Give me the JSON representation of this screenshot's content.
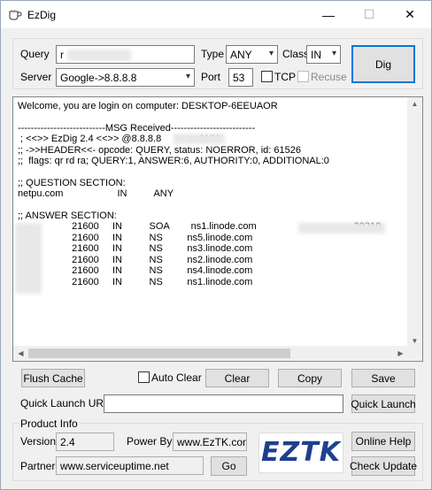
{
  "window": {
    "title": "EzDig",
    "minimize_glyph": "—",
    "maximize_glyph": "☐",
    "close_glyph": "✕"
  },
  "query": {
    "query_label": "Query",
    "query_value": "r",
    "type_label": "Type",
    "type_value": "ANY",
    "class_label": "Class",
    "class_value": "IN",
    "server_label": "Server",
    "server_value": "Google->8.8.8.8",
    "port_label": "Port",
    "port_value": "53",
    "tcp_label": "TCP",
    "tcp_checked": false,
    "recurse_label": "Recuse",
    "recurse_enabled": false,
    "dig_label": "Dig"
  },
  "output": {
    "lines": [
      "Welcome, you are login on computer: DESKTOP-6EEUAOR",
      "",
      "---------------------------MSG Received--------------------------",
      " ; <<>> EzDig 2.4 <<>> @8.8.8.8          m ANY",
      ";; ->>HEADER<<- opcode: QUERY, status: NOERROR, id: 61526",
      ";;  flags: qr rd ra; QUERY:1, ANSWER:6, AUTHORITY:0, ADDITIONAL:0",
      "",
      ";; QUESTION SECTION:",
      "netpu.com                    IN          ANY",
      "",
      ";; ANSWER SECTION:",
      "                    21600     IN          SOA        ns1.linode.com                                    20210",
      "                    21600     IN          NS         ns5.linode.com",
      "                    21600     IN          NS         ns3.linode.com",
      "                    21600     IN          NS         ns2.linode.com",
      "                    21600     IN          NS         ns4.linode.com",
      "                    21600     IN          NS         ns1.linode.com"
    ]
  },
  "actions": {
    "flush_cache_label": "Flush Cache",
    "auto_clear_label": "Auto Clear",
    "auto_clear_checked": false,
    "clear_label": "Clear",
    "copy_label": "Copy",
    "save_label": "Save",
    "quick_launch_url_label": "Quick Launch URL",
    "quick_launch_url_value": "",
    "quick_launch_label": "Quick Launch"
  },
  "product": {
    "section_label": "Product Info",
    "version_label": "Version",
    "version_value": "2.4",
    "powered_by_label": "Power By",
    "powered_by_value": "www.EzTK.com",
    "partner_label": "Partner",
    "partner_value": "www.serviceuptime.net",
    "go_label": "Go",
    "logo_text": "EZTK",
    "online_help_label": "Online Help",
    "check_update_label": "Check Update"
  },
  "colors": {
    "logo_blue": "#1f3f8f",
    "default_button_border": "#0078d7",
    "window_background": "#f0f0f0"
  }
}
